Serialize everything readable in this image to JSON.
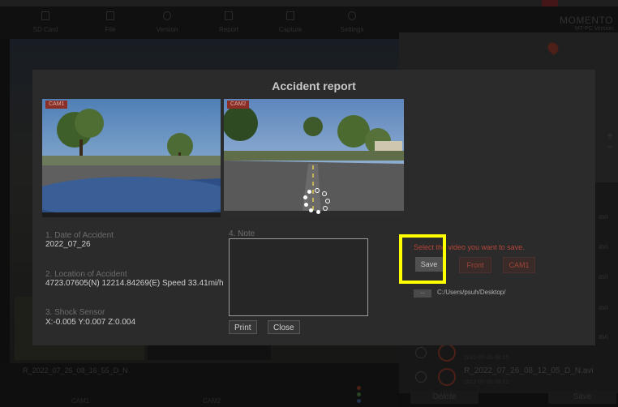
{
  "app": {
    "toolbar": [
      "SD Card",
      "File",
      "Version",
      "Report",
      "Capture",
      "Settings"
    ],
    "brand": "MOMENTO",
    "brand_sub": "MT-PC Version"
  },
  "background": {
    "file_label": "R_2022_07_26_08_16_55_D_N",
    "cam1": "CAM1",
    "cam2": "CAM2",
    "list_rows": [
      {
        "name": "",
        "date": "2022-07-26 08:15"
      },
      {
        "name": "R_2022_07_26_08_12_05_D_N.avi",
        "date": "2022-07-26 08:12"
      }
    ],
    "list_side": [
      "avi",
      "avi",
      "avi",
      "avi",
      "avi",
      "avi"
    ],
    "delete_label": "Delete",
    "save_label": "Save"
  },
  "modal": {
    "title": "Accident report",
    "cam_tag_1": "CAM1",
    "cam_tag_2": "CAM2",
    "date_label": "1. Date of Accident",
    "date_value": "2022_07_26",
    "location_label": "2. Location of Accident",
    "location_value": "4723.07605(N) 12214.84269(E) Speed 33.41mi/h",
    "shock_label": "3. Shock Sensor",
    "shock_value": "X:-0.005  Y:0.007  Z:0.004",
    "note_label": "4. Note",
    "print_label": "Print",
    "close_label": "Close",
    "select_text": "Select the video you want to save.",
    "save_option": "Save",
    "front_option": "Front",
    "cam1_option": "CAM1",
    "browse_label": "...",
    "save_path": "C:/Users/psuh/Desktop/"
  },
  "colors": {
    "highlight": "#ffff00",
    "accent_red": "#b5453a"
  }
}
